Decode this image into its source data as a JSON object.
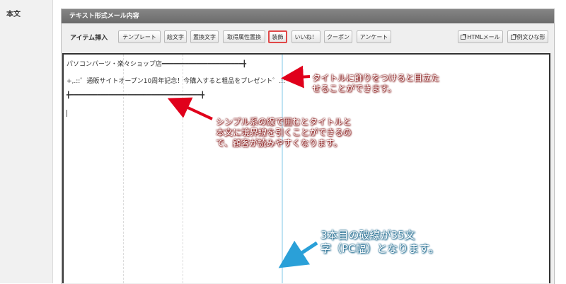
{
  "field_label": "本文",
  "panel": {
    "title": "テキスト形式メール内容"
  },
  "toolbar": {
    "item_insert_label": "アイテム挿入",
    "buttons": [
      {
        "label": "テンプレート"
      },
      {
        "label": "絵文字"
      },
      {
        "label": "置換文字"
      },
      {
        "label": "取得属性置換"
      },
      {
        "label": "装飾"
      },
      {
        "label": "いいね！"
      },
      {
        "label": "クーポン"
      },
      {
        "label": "アンケート"
      }
    ],
    "right_buttons": [
      {
        "label": "HTMLメール"
      },
      {
        "label": "例文ひな形"
      }
    ]
  },
  "editor": {
    "line1": "パソコンパーツ・楽々ショップ店━━━━━━━━━━━━━━━━━━━━━╋",
    "line2": "+,.::゜通販サイトオープン10周年記念！今購入すると粗品をプレゼント゜.::゜.",
    "line3": "╋━━━━━━━━━━━━━━━━━━━━━━━━━━━━━━━━━━╋"
  },
  "annotations": {
    "note1": [
      "タイトルに飾りをつけると目立た",
      "せることができます。"
    ],
    "note2": [
      "シンプル系の線で囲むとタイトルと",
      "本文に境界線を引くことができるの",
      "で、顧客が読みやすくなります。"
    ],
    "note3": [
      "3本目の破線が35文",
      "字（PC幅）となります。"
    ]
  },
  "colors": {
    "highlight_border": "#e04848",
    "red_arrow": "#e0001b",
    "blue_arrow": "#2aa0d8",
    "header_bg": "#777777"
  }
}
